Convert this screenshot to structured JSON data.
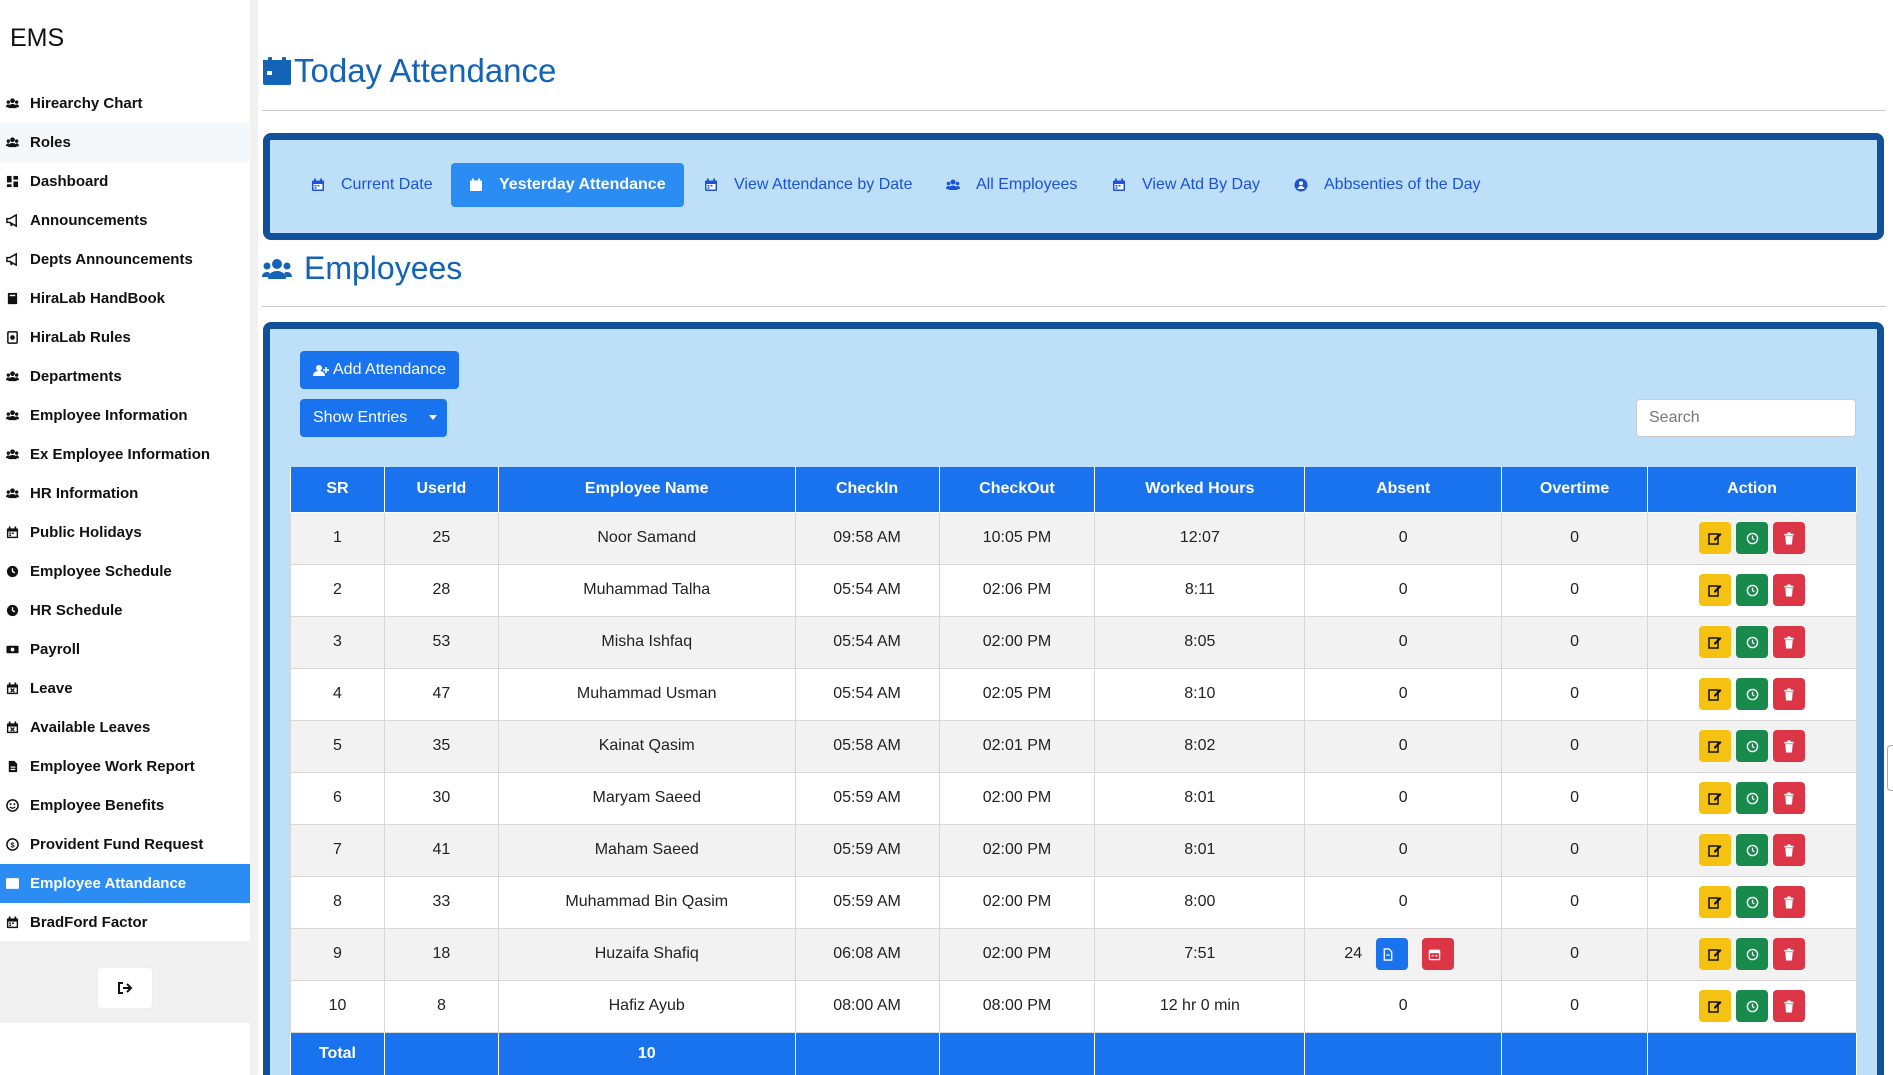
{
  "app": {
    "brand": "EMS"
  },
  "sidebar": {
    "items": [
      {
        "label": "Hirearchy Chart",
        "icon": "users-icon"
      },
      {
        "label": "Roles",
        "icon": "users-icon"
      },
      {
        "label": "Dashboard",
        "icon": "dashboard-icon"
      },
      {
        "label": "Announcements",
        "icon": "megaphone-icon"
      },
      {
        "label": "Depts Announcements",
        "icon": "megaphone-icon"
      },
      {
        "label": "HiraLab HandBook",
        "icon": "book-icon"
      },
      {
        "label": "HiraLab Rules",
        "icon": "rules-book-icon"
      },
      {
        "label": "Departments",
        "icon": "users-icon"
      },
      {
        "label": "Employee Information",
        "icon": "users-icon"
      },
      {
        "label": "Ex Employee Information",
        "icon": "users-icon"
      },
      {
        "label": "HR Information",
        "icon": "users-icon"
      },
      {
        "label": "Public Holidays",
        "icon": "calendar-icon"
      },
      {
        "label": "Employee Schedule",
        "icon": "clock-icon"
      },
      {
        "label": "HR Schedule",
        "icon": "clock-icon"
      },
      {
        "label": "Payroll",
        "icon": "money-icon"
      },
      {
        "label": "Leave",
        "icon": "calendar-x-icon"
      },
      {
        "label": "Available Leaves",
        "icon": "calendar-x-icon"
      },
      {
        "label": "Employee Work Report",
        "icon": "file-icon"
      },
      {
        "label": "Employee Benefits",
        "icon": "smile-icon"
      },
      {
        "label": "Provident Fund Request",
        "icon": "coin-icon"
      },
      {
        "label": "Employee Attandance",
        "icon": "id-card-icon"
      },
      {
        "label": "BradFord Factor",
        "icon": "calendar-icon"
      }
    ],
    "active_index": 20,
    "hover_index": 1
  },
  "header": {
    "title": "Today Attendance"
  },
  "tabs": [
    {
      "label": "Current Date",
      "icon": "calendar-icon"
    },
    {
      "label": "Yesterday Attendance",
      "icon": "calendar-icon",
      "active": true
    },
    {
      "label": "View Attendance by Date",
      "icon": "calendar-icon"
    },
    {
      "label": "All Employees",
      "icon": "users-icon"
    },
    {
      "label": "View Atd By Day",
      "icon": "calendar-icon"
    },
    {
      "label": "Abbsenties of the Day",
      "icon": "user-x-icon"
    }
  ],
  "employees": {
    "title": "Employees",
    "add_label": "Add Attendance",
    "entries_label": "Show Entries",
    "search_placeholder": "Search"
  },
  "table": {
    "columns": [
      "SR",
      "UserId",
      "Employee Name",
      "CheckIn",
      "CheckOut",
      "Worked Hours",
      "Absent",
      "Overtime",
      "Action"
    ],
    "rows": [
      {
        "sr": "1",
        "userid": "25",
        "name": "Noor Samand",
        "checkin": "09:58 AM",
        "checkout": "10:05 PM",
        "worked": "12:07",
        "absent": "0",
        "overtime": "0"
      },
      {
        "sr": "2",
        "userid": "28",
        "name": "Muhammad Talha",
        "checkin": "05:54 AM",
        "checkout": "02:06 PM",
        "worked": "8:11",
        "absent": "0",
        "overtime": "0"
      },
      {
        "sr": "3",
        "userid": "53",
        "name": "Misha Ishfaq",
        "checkin": "05:54 AM",
        "checkout": "02:00 PM",
        "worked": "8:05",
        "absent": "0",
        "overtime": "0"
      },
      {
        "sr": "4",
        "userid": "47",
        "name": "Muhammad Usman",
        "checkin": "05:54 AM",
        "checkout": "02:05 PM",
        "worked": "8:10",
        "absent": "0",
        "overtime": "0"
      },
      {
        "sr": "5",
        "userid": "35",
        "name": "Kainat Qasim",
        "checkin": "05:58 AM",
        "checkout": "02:01 PM",
        "worked": "8:02",
        "absent": "0",
        "overtime": "0"
      },
      {
        "sr": "6",
        "userid": "30",
        "name": "Maryam Saeed",
        "checkin": "05:59 AM",
        "checkout": "02:00 PM",
        "worked": "8:01",
        "absent": "0",
        "overtime": "0"
      },
      {
        "sr": "7",
        "userid": "41",
        "name": "Maham Saeed",
        "checkin": "05:59 AM",
        "checkout": "02:00 PM",
        "worked": "8:01",
        "absent": "0",
        "overtime": "0"
      },
      {
        "sr": "8",
        "userid": "33",
        "name": "Muhammad Bin Qasim",
        "checkin": "05:59 AM",
        "checkout": "02:00 PM",
        "worked": "8:00",
        "absent": "0",
        "overtime": "0"
      },
      {
        "sr": "9",
        "userid": "18",
        "name": "Huzaifa Shafiq",
        "checkin": "06:08 AM",
        "checkout": "02:00 PM",
        "worked": "7:51",
        "absent": "24",
        "overtime": "0",
        "absent_actions": true
      },
      {
        "sr": "10",
        "userid": "8",
        "name": "Hafiz Ayub",
        "checkin": "08:00 AM",
        "checkout": "08:00 PM",
        "worked": "12 hr 0 min",
        "absent": "0",
        "overtime": "0"
      }
    ],
    "total_label": "Total",
    "total_value": "10"
  },
  "colors": {
    "primary": "#1a73ee",
    "panel_bg": "#bddff8",
    "panel_border": "#10519a",
    "title": "#1363b7",
    "edit": "#f5c211",
    "time": "#178a4c",
    "delete": "#dc3545"
  }
}
